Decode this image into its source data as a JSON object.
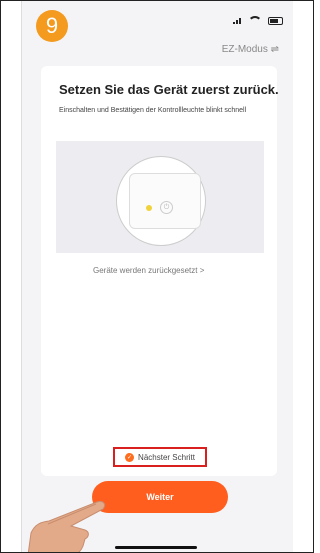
{
  "step_number": "9",
  "header": {
    "mode_label": "EZ-Modus ⇌"
  },
  "content": {
    "title": "Setzen Sie das Gerät zuerst zurück.",
    "description": "Einschalten und Bestätigen der Kontrollleuchte blinkt schnell",
    "reset_link": "Geräte werden zurückgesetzt >"
  },
  "footer": {
    "next_step_label": "Nächster Schritt",
    "continue_label": "Weiter"
  },
  "colors": {
    "accent": "#ff5e1f",
    "badge": "#f39a1f",
    "highlight_border": "#d9201f"
  }
}
